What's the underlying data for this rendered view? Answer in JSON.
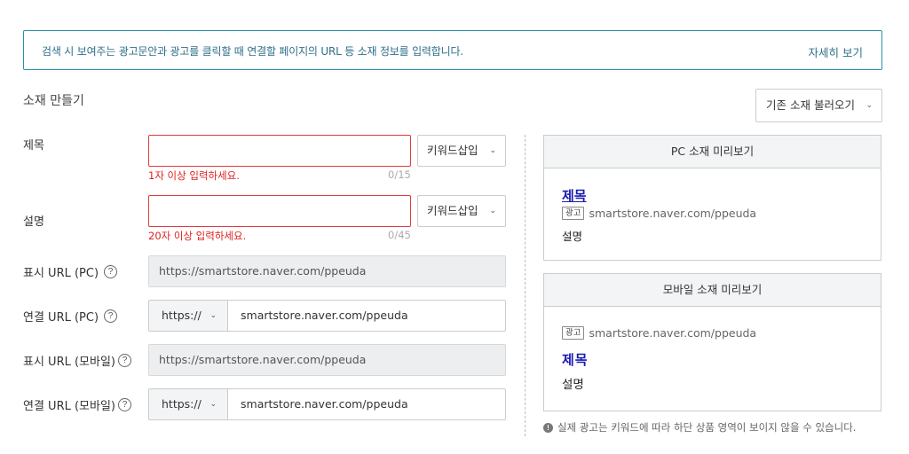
{
  "info": {
    "text": "검색 시 보여주는 광고문안과 광고를 클릭할 때 연결할 페이지의 URL 등 소재 정보를 입력합니다.",
    "link": "자세히 보기"
  },
  "section_title": "소재 만들기",
  "load_button": "기존 소재 불러오기",
  "form": {
    "title": {
      "label": "제목",
      "value": "",
      "keyword_button": "키워드삽입",
      "error": "1자 이상 입력하세요.",
      "counter": "0/15"
    },
    "description": {
      "label": "설명",
      "value": "",
      "keyword_button": "키워드삽입",
      "error": "20자 이상 입력하세요.",
      "counter": "0/45"
    },
    "display_url_pc": {
      "label": "표시 URL (PC)",
      "value": "https://smartstore.naver.com/ppeuda"
    },
    "link_url_pc": {
      "label": "연결 URL (PC)",
      "protocol": "https://",
      "value": "smartstore.naver.com/ppeuda"
    },
    "display_url_mobile": {
      "label": "표시 URL (모바일)",
      "value": "https://smartstore.naver.com/ppeuda"
    },
    "link_url_mobile": {
      "label": "연결 URL (모바일)",
      "protocol": "https://",
      "value": "smartstore.naver.com/ppeuda"
    },
    "help_glyph": "?"
  },
  "preview_pc": {
    "header": "PC 소재 미리보기",
    "title": "제목",
    "badge": "광고",
    "url": "smartstore.naver.com/ppeuda",
    "description": "설명"
  },
  "preview_mobile": {
    "header": "모바일 소재 미리보기",
    "badge": "광고",
    "url": "smartstore.naver.com/ppeuda",
    "title": "제목",
    "description": "설명"
  },
  "note": "실제 광고는 키워드에 따라 하단 상품 영역이 보이지 않을 수 있습니다.",
  "icons": {
    "chevron": "chevron-down-icon",
    "help": "help-circle-icon",
    "info": "info-circle-icon"
  },
  "colors": {
    "accent": "#2a8fa8",
    "error": "#e02020",
    "preview_link": "#1a1ab0"
  }
}
